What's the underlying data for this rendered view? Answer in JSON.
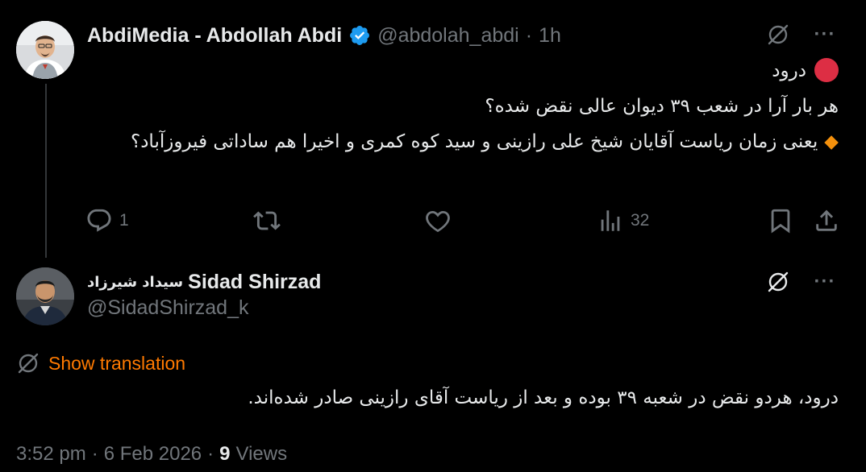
{
  "tweet": {
    "author_name": "AbdiMedia - Abdollah Abdi",
    "author_handle": "@abdolah_abdi",
    "separator": "·",
    "time_ago": "1h",
    "greeting": "درود",
    "line1": "هر بار آرا در شعب ۳۹ دیوان عالی نقض شده؟",
    "line2": "یعنی زمان ریاست آقایان شیخ علی رازینی و سید کوه کمری و اخیرا هم ساداتی فیروزآباد؟",
    "reply_count": "1",
    "view_count": "32"
  },
  "reply": {
    "author_name_en": "Sidad Shirzad",
    "author_name_fa": "سیداد شیرزاد",
    "author_handle": "@SidadShirzad_k",
    "show_translation": "Show translation",
    "text": "درود، هردو نقض در شعبه ۳۹ بوده و بعد از ریاست آقای رازینی صادر شده‌اند.",
    "time": "3:52 pm",
    "date": "6 Feb 2026",
    "sep": "·",
    "views_count": "9",
    "views_label": "Views"
  },
  "icons": {
    "verified": "verified-badge-icon",
    "no_translate": "translate-off-icon",
    "more": "more-icon",
    "reply": "reply-icon",
    "retweet": "retweet-icon",
    "like": "heart-icon",
    "views": "analytics-icon",
    "bookmark": "bookmark-icon",
    "share": "share-icon"
  },
  "colors": {
    "background": "#000000",
    "text": "#e7e9ea",
    "muted": "#71767b",
    "verified": "#1d9bf0",
    "translation_link": "#ff7a00",
    "red_circle": "#dd2e44",
    "orange_diamond": "#f4900c"
  }
}
